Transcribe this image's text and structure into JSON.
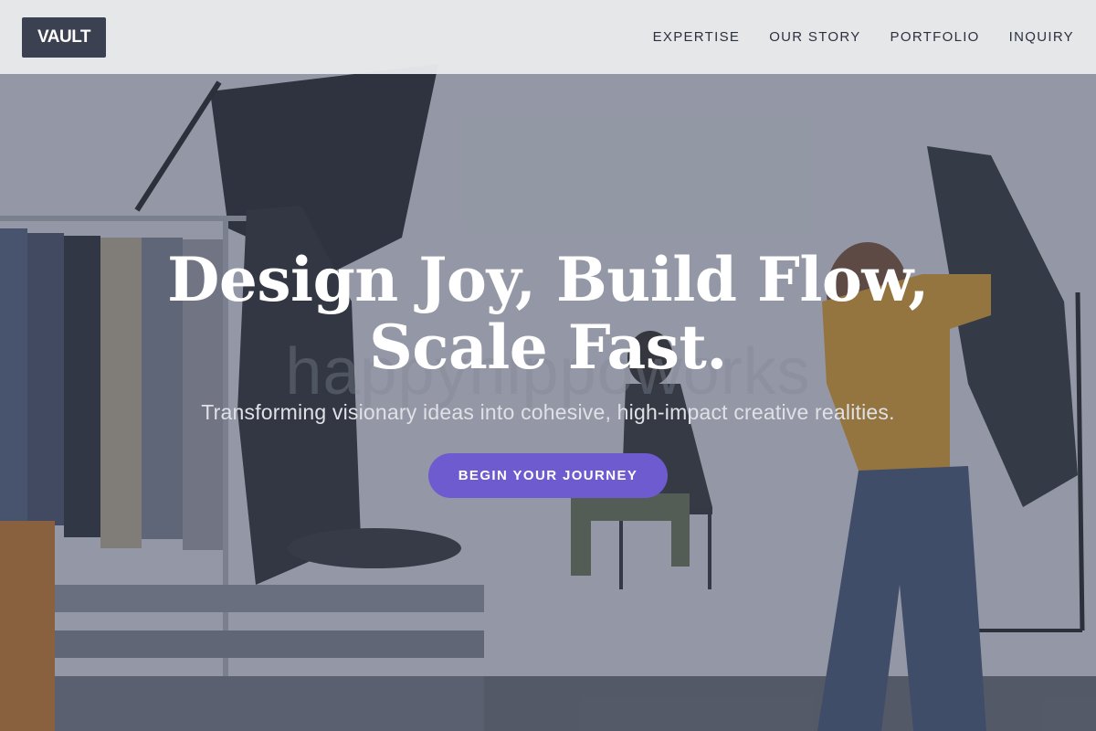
{
  "header": {
    "logo_text": "VAULT",
    "nav": [
      {
        "label": "EXPERTISE"
      },
      {
        "label": "OUR STORY"
      },
      {
        "label": "PORTFOLIO"
      },
      {
        "label": "INQUIRY"
      }
    ]
  },
  "hero": {
    "watermark": "happyhippoworks",
    "title_line1": "Design Joy, Build Flow,",
    "title_line2": "Scale Fast.",
    "subtitle": "Transforming visionary ideas into cohesive, high-impact creative realities.",
    "cta_label": "BEGIN YOUR JOURNEY"
  },
  "colors": {
    "header_bg": "#e8e9eb",
    "logo_bg": "#3b4150",
    "cta_bg": "#6e5bd0",
    "title": "#ffffff"
  }
}
